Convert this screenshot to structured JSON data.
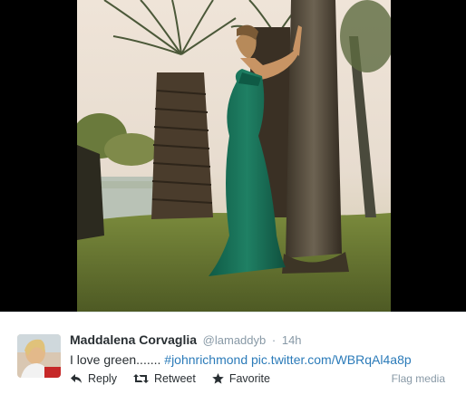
{
  "tweet": {
    "fullname": "Maddalena Corvaglia",
    "username": "@lamaddyb",
    "separator": "·",
    "time": "14h",
    "text": "I love green.......",
    "hashtag": "#johnrichmond",
    "media_link": "pic.twitter.com/WBRqAl4a8p"
  },
  "actions": {
    "reply": "Reply",
    "retweet": "Retweet",
    "favorite": "Favorite",
    "flag_media": "Flag media"
  },
  "icons": {
    "reply": "reply-arrow-icon",
    "retweet": "retweet-icon",
    "favorite": "star-icon"
  },
  "colors": {
    "name": "#292f33",
    "meta": "#8899a6",
    "link": "#2b7bb9",
    "media_bg": "#000000"
  }
}
